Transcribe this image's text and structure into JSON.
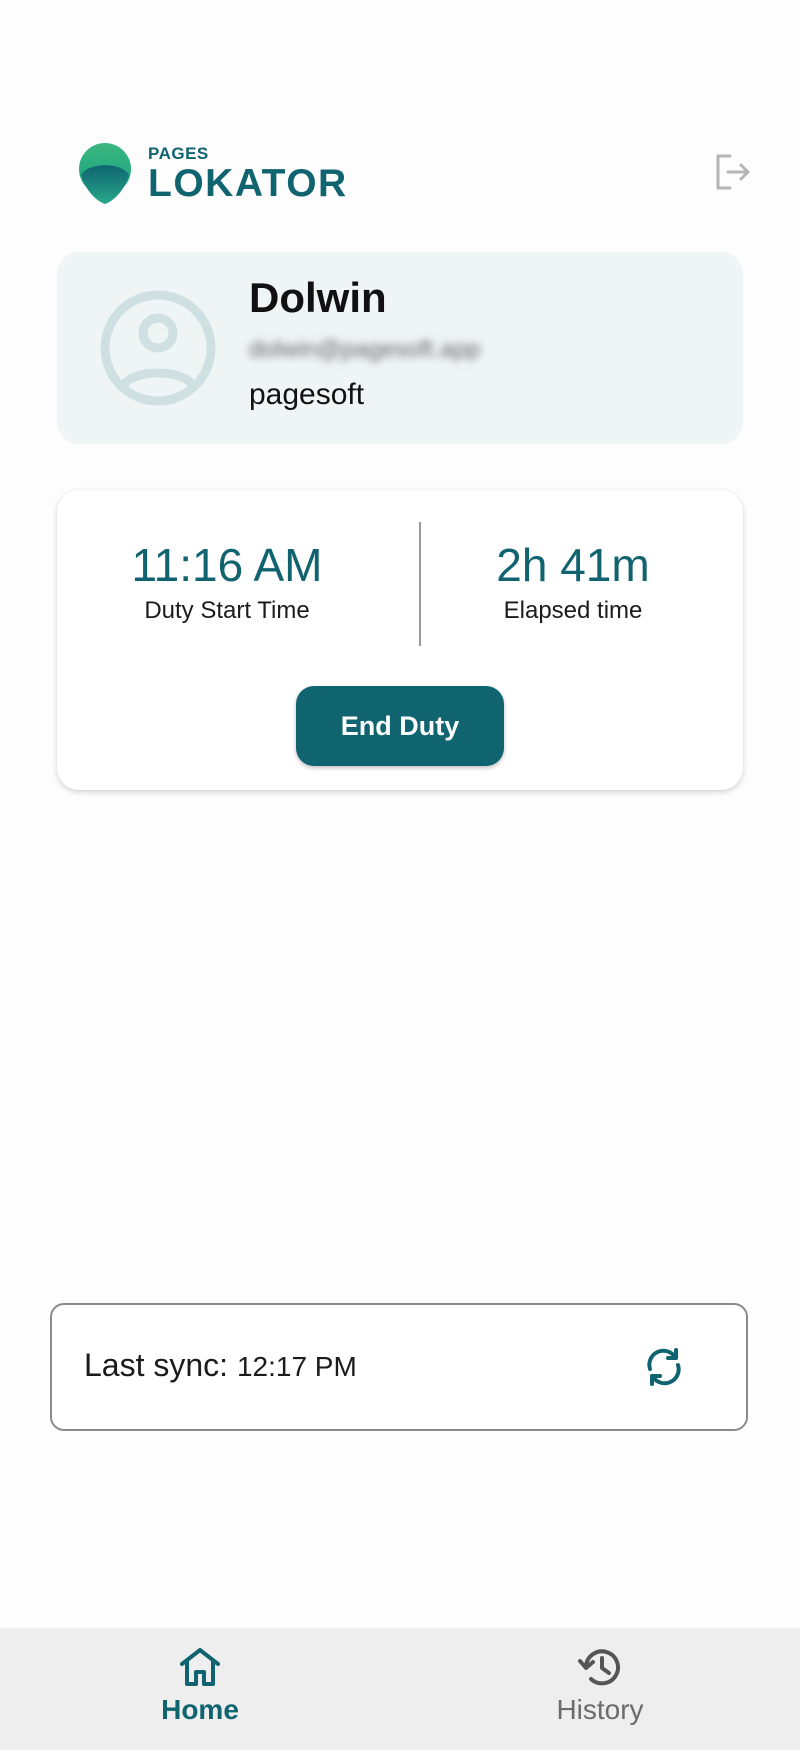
{
  "header": {
    "logo_small": "PAGES",
    "logo_big": "LOKATOR"
  },
  "profile": {
    "name": "Dolwin",
    "email": "dolwin@pagesoft.app",
    "organization": "pagesoft"
  },
  "duty": {
    "start_time": "11:16 AM",
    "start_label": "Duty Start Time",
    "elapsed_time": "2h 41m",
    "elapsed_label": "Elapsed time",
    "end_button_label": "End Duty"
  },
  "sync": {
    "label": "Last sync:",
    "time": "12:17 PM"
  },
  "nav": {
    "home_label": "Home",
    "history_label": "History",
    "active": "Home"
  },
  "colors": {
    "primary": "#0f6470",
    "profile_card_bg": "#eff4f5",
    "nav_bg": "#eeeeee"
  },
  "icons": {
    "logout": "logout-icon",
    "avatar": "user-circle-icon",
    "sync": "sync-icon",
    "home": "home-icon",
    "history": "history-icon"
  }
}
